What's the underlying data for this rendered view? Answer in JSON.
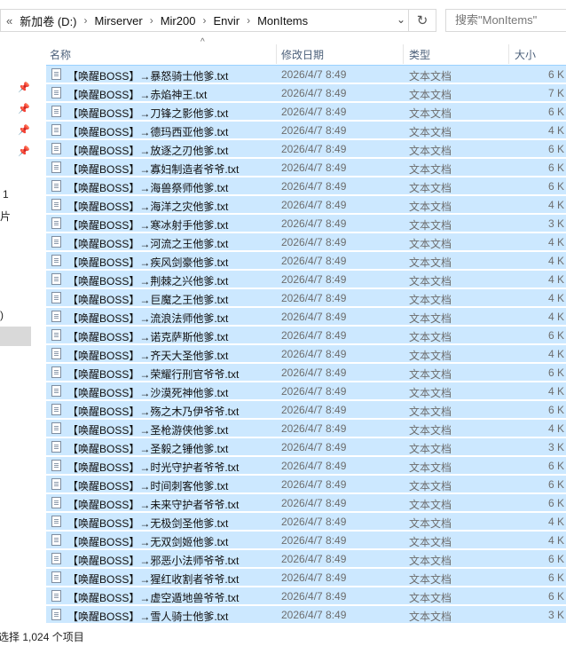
{
  "address": {
    "back_chevron": "«",
    "segments": [
      "新加卷 (D:)",
      "Mirserver",
      "Mir200",
      "Envir",
      "MonItems"
    ],
    "dropdown_glyph": "⌄",
    "refresh_glyph": "↻",
    "search_placeholder": "搜索\"MonItems\""
  },
  "nav": {
    "pins": [
      "pin-icon",
      "pin-icon",
      "pin-icon",
      "pin-icon"
    ],
    "text1": "1",
    "text2": "照片",
    "text3": ")"
  },
  "columns": {
    "name": "名称",
    "date": "修改日期",
    "type": "类型",
    "size": "大小",
    "sort_glyph": "^"
  },
  "files": [
    {
      "name": "【唤醒BOSS】→暴怒骑士他爹.txt",
      "date": "2026/4/7 8:49",
      "type": "文本文档",
      "size": "6 K"
    },
    {
      "name": "【唤醒BOSS】→赤焰神王.txt",
      "date": "2026/4/7 8:49",
      "type": "文本文档",
      "size": "7 K"
    },
    {
      "name": "【唤醒BOSS】→刀锋之影他爹.txt",
      "date": "2026/4/7 8:49",
      "type": "文本文档",
      "size": "6 K"
    },
    {
      "name": "【唤醒BOSS】→德玛西亚他爹.txt",
      "date": "2026/4/7 8:49",
      "type": "文本文档",
      "size": "4 K"
    },
    {
      "name": "【唤醒BOSS】→放逐之刃他爹.txt",
      "date": "2026/4/7 8:49",
      "type": "文本文档",
      "size": "6 K"
    },
    {
      "name": "【唤醒BOSS】→寡妇制造者爷爷.txt",
      "date": "2026/4/7 8:49",
      "type": "文本文档",
      "size": "6 K"
    },
    {
      "name": "【唤醒BOSS】→海兽祭师他爹.txt",
      "date": "2026/4/7 8:49",
      "type": "文本文档",
      "size": "6 K"
    },
    {
      "name": "【唤醒BOSS】→海洋之灾他爹.txt",
      "date": "2026/4/7 8:49",
      "type": "文本文档",
      "size": "4 K"
    },
    {
      "name": "【唤醒BOSS】→寒冰射手他爹.txt",
      "date": "2026/4/7 8:49",
      "type": "文本文档",
      "size": "3 K"
    },
    {
      "name": "【唤醒BOSS】→河流之王他爹.txt",
      "date": "2026/4/7 8:49",
      "type": "文本文档",
      "size": "4 K"
    },
    {
      "name": "【唤醒BOSS】→疾风剑豪他爹.txt",
      "date": "2026/4/7 8:49",
      "type": "文本文档",
      "size": "4 K"
    },
    {
      "name": "【唤醒BOSS】→荆棘之兴他爹.txt",
      "date": "2026/4/7 8:49",
      "type": "文本文档",
      "size": "4 K"
    },
    {
      "name": "【唤醒BOSS】→巨魔之王他爹.txt",
      "date": "2026/4/7 8:49",
      "type": "文本文档",
      "size": "4 K"
    },
    {
      "name": "【唤醒BOSS】→流浪法师他爹.txt",
      "date": "2026/4/7 8:49",
      "type": "文本文档",
      "size": "4 K"
    },
    {
      "name": "【唤醒BOSS】→诺克萨斯他爹.txt",
      "date": "2026/4/7 8:49",
      "type": "文本文档",
      "size": "6 K"
    },
    {
      "name": "【唤醒BOSS】→齐天大圣他爹.txt",
      "date": "2026/4/7 8:49",
      "type": "文本文档",
      "size": "4 K"
    },
    {
      "name": "【唤醒BOSS】→荣耀行刑官爷爷.txt",
      "date": "2026/4/7 8:49",
      "type": "文本文档",
      "size": "6 K"
    },
    {
      "name": "【唤醒BOSS】→沙漠死神他爹.txt",
      "date": "2026/4/7 8:49",
      "type": "文本文档",
      "size": "4 K"
    },
    {
      "name": "【唤醒BOSS】→殇之木乃伊爷爷.txt",
      "date": "2026/4/7 8:49",
      "type": "文本文档",
      "size": "6 K"
    },
    {
      "name": "【唤醒BOSS】→圣枪游侠他爹.txt",
      "date": "2026/4/7 8:49",
      "type": "文本文档",
      "size": "4 K"
    },
    {
      "name": "【唤醒BOSS】→圣毅之锤他爹.txt",
      "date": "2026/4/7 8:49",
      "type": "文本文档",
      "size": "3 K"
    },
    {
      "name": "【唤醒BOSS】→时光守护者爷爷.txt",
      "date": "2026/4/7 8:49",
      "type": "文本文档",
      "size": "6 K"
    },
    {
      "name": "【唤醒BOSS】→时间刺客他爹.txt",
      "date": "2026/4/7 8:49",
      "type": "文本文档",
      "size": "6 K"
    },
    {
      "name": "【唤醒BOSS】→未来守护者爷爷.txt",
      "date": "2026/4/7 8:49",
      "type": "文本文档",
      "size": "6 K"
    },
    {
      "name": "【唤醒BOSS】→无极剑圣他爹.txt",
      "date": "2026/4/7 8:49",
      "type": "文本文档",
      "size": "4 K"
    },
    {
      "name": "【唤醒BOSS】→无双剑姬他爹.txt",
      "date": "2026/4/7 8:49",
      "type": "文本文档",
      "size": "4 K"
    },
    {
      "name": "【唤醒BOSS】→邪恶小法师爷爷.txt",
      "date": "2026/4/7 8:49",
      "type": "文本文档",
      "size": "6 K"
    },
    {
      "name": "【唤醒BOSS】→猩红收割者爷爷.txt",
      "date": "2026/4/7 8:49",
      "type": "文本文档",
      "size": "6 K"
    },
    {
      "name": "【唤醒BOSS】→虚空遁地兽爷爷.txt",
      "date": "2026/4/7 8:49",
      "type": "文本文档",
      "size": "6 K"
    },
    {
      "name": "【唤醒BOSS】→雪人骑士他爹.txt",
      "date": "2026/4/7 8:49",
      "type": "文本文档",
      "size": "3 K"
    }
  ],
  "status": {
    "text": "选择 1,024 个项目"
  },
  "colors": {
    "selection": "#cce8ff",
    "header_text": "#4c607a",
    "meta_text": "#6d6d6d"
  }
}
